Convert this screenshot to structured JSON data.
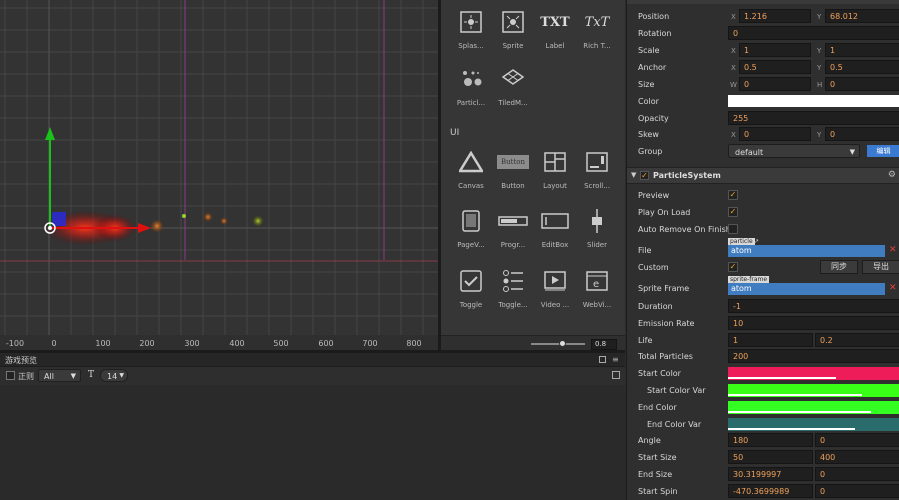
{
  "scene": {
    "ruler_labels": [
      "-100",
      "0",
      "100",
      "200",
      "300",
      "400",
      "500",
      "600",
      "700",
      "800"
    ]
  },
  "widgets": {
    "row1": [
      {
        "icon": "splash-icon",
        "label": "Splas..."
      },
      {
        "icon": "sprite-icon",
        "label": "Sprite"
      },
      {
        "icon": "label-icon",
        "label": "Label",
        "glyph": "TXT"
      },
      {
        "icon": "richtext-icon",
        "label": "Rich T...",
        "glyph": "TxT"
      }
    ],
    "row2": [
      {
        "icon": "particle-icon",
        "label": "Particl..."
      },
      {
        "icon": "tiledmap-icon",
        "label": "TiledM..."
      }
    ],
    "ui_heading": "UI",
    "row3": [
      {
        "icon": "canvas-icon",
        "label": "Canvas"
      },
      {
        "icon": "button-icon",
        "label": "Button",
        "glyph": "Button"
      },
      {
        "icon": "layout-icon",
        "label": "Layout"
      },
      {
        "icon": "scrollview-icon",
        "label": "Scroll..."
      }
    ],
    "row4": [
      {
        "icon": "pageview-icon",
        "label": "PageV..."
      },
      {
        "icon": "progressbar-icon",
        "label": "Progr..."
      },
      {
        "icon": "editbox-icon",
        "label": "EditBox"
      },
      {
        "icon": "slider-icon",
        "label": "Slider"
      }
    ],
    "row5": [
      {
        "icon": "toggle-icon",
        "label": "Toggle"
      },
      {
        "icon": "togglegroup-icon",
        "label": "Toggle..."
      },
      {
        "icon": "video-icon",
        "label": "Video ..."
      },
      {
        "icon": "webview-icon",
        "label": "WebVi..."
      }
    ],
    "zoom_value": "0.8",
    "zoom_level": 0.6
  },
  "game_preview": {
    "title": "游戏预览",
    "regex_label": "正则",
    "filter_select": "All",
    "font_size": "14"
  },
  "inspector": {
    "position": {
      "label": "Position",
      "x": "1.216",
      "y": "68.012",
      "x_axis": "X",
      "y_axis": "Y"
    },
    "rotation": {
      "label": "Rotation",
      "value": "0"
    },
    "scale": {
      "label": "Scale",
      "x": "1",
      "y": "1"
    },
    "anchor": {
      "label": "Anchor",
      "x": "0.5",
      "y": "0.5"
    },
    "size": {
      "label": "Size",
      "w": "0",
      "h": "0",
      "w_axis": "W",
      "h_axis": "H"
    },
    "color": {
      "label": "Color",
      "value": "#ffffff"
    },
    "opacity": {
      "label": "Opacity",
      "value": "255"
    },
    "skew": {
      "label": "Skew",
      "x": "0",
      "y": "0"
    },
    "group": {
      "label": "Group",
      "value": "default",
      "edit_button": "编辑"
    },
    "particle_system": {
      "header": "ParticleSystem",
      "preview": "Preview",
      "play_on_load": "Play On Load",
      "auto_remove": "Auto Remove On Finish",
      "file": {
        "label": "File",
        "tag": "particle",
        "value": "atom"
      },
      "custom": {
        "label": "Custom",
        "sync": "同步",
        "export": "导出"
      },
      "sprite_frame": {
        "label": "Sprite Frame",
        "tag": "sprite-frame",
        "value": "atom"
      },
      "duration": {
        "label": "Duration",
        "value": "-1"
      },
      "emission_rate": {
        "label": "Emission Rate",
        "value": "10"
      },
      "life": {
        "label": "Life",
        "a": "1",
        "b": "0.2"
      },
      "total_particles": {
        "label": "Total Particles",
        "value": "200"
      },
      "start_color": {
        "label": "Start Color",
        "color": "#ee1d5a",
        "alpha": 0.63
      },
      "start_color_var": {
        "label": "Start Color Var",
        "color": "#39ff17",
        "alpha": 0.78
      },
      "end_color": {
        "label": "End Color",
        "color": "#33ff22",
        "alpha": 0.83
      },
      "end_color_var": {
        "label": "End Color Var",
        "color": "#2a6b6b",
        "alpha": 0.74
      },
      "angle": {
        "label": "Angle",
        "a": "180",
        "b": "0"
      },
      "start_size": {
        "label": "Start Size",
        "a": "50",
        "b": "400"
      },
      "end_size": {
        "label": "End Size",
        "a": "30.3199997",
        "b": "0"
      },
      "start_spin": {
        "label": "Start Spin",
        "a": "-470.3699989",
        "b": "0"
      }
    }
  }
}
